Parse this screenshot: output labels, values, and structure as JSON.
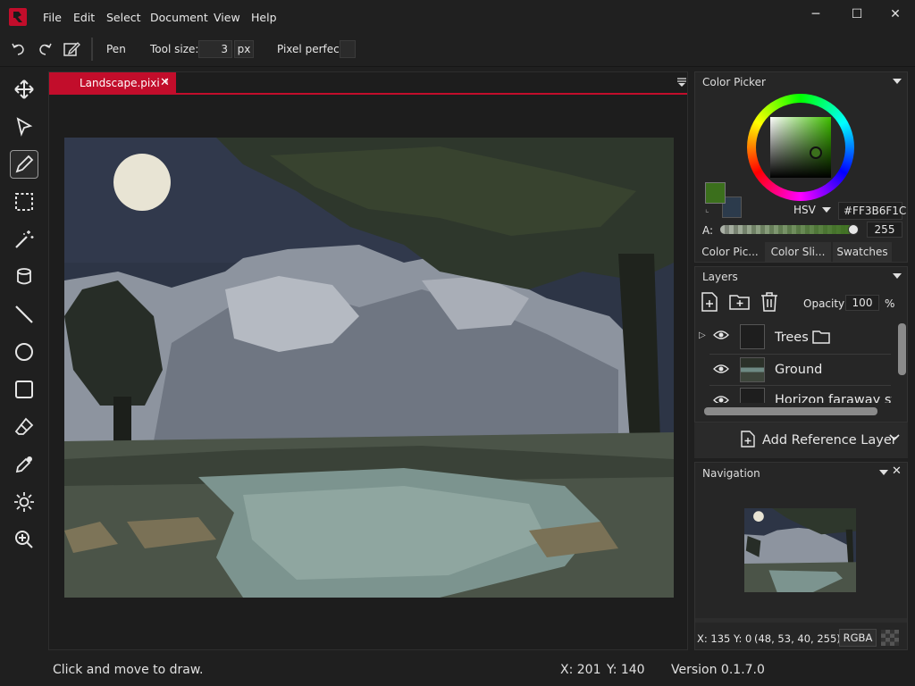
{
  "menu": {
    "items": [
      "File",
      "Edit",
      "Select",
      "Document",
      "View",
      "Help"
    ]
  },
  "window_controls": {
    "minimize": "─",
    "maximize": "☐",
    "close": "✕"
  },
  "toolbar": {
    "tool_name": "Pen",
    "tool_size_label": "Tool size:",
    "tool_size_value": "3",
    "tool_size_unit": "px",
    "pixel_perfect_label": "Pixel perfect"
  },
  "tools": [
    "move",
    "select",
    "pen",
    "rectangle-select",
    "magic-wand",
    "bucket",
    "line",
    "ellipse",
    "rectangle",
    "eraser",
    "color-picker",
    "brightness",
    "zoom"
  ],
  "document": {
    "tab_title": "Landscape.pixi *",
    "tab_close": "✕"
  },
  "color_picker": {
    "title": "Color Picker",
    "primary_color": "#3b6f1c",
    "secondary_color": "#2c3b4c",
    "mode": "HSV",
    "hex_value": "#FF3B6F1C",
    "alpha_label": "A:",
    "alpha_value": "255",
    "tabs": [
      "Color Pic...",
      "Color Sli...",
      "Swatches"
    ]
  },
  "layers": {
    "title": "Layers",
    "opacity_label": "Opacity",
    "opacity_value": "100",
    "opacity_unit": "%",
    "items": [
      {
        "name": "Trees"
      },
      {
        "name": "Ground"
      },
      {
        "name": "Horizon faraway stu"
      }
    ],
    "add_reference_label": "Add Reference Layer"
  },
  "navigation": {
    "title": "Navigation",
    "coords": "X: 135 Y: 0",
    "rgba_value": "(48, 53, 40, 255)",
    "rgba_button": "RGBA"
  },
  "status": {
    "hint": "Click and move to draw.",
    "x": "X: 201",
    "y": "Y: 140",
    "version": "Version 0.1.7.0"
  },
  "colors": {
    "accent": "#c20d2b",
    "sky": "#2d3546",
    "mountain": "#9aa1ab",
    "tree_dark": "#2c3328",
    "ground": "#4b5448",
    "river": "#7c948f"
  }
}
